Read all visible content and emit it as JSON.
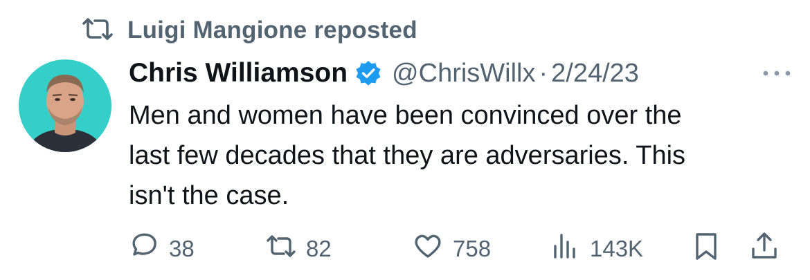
{
  "repost_banner": {
    "icon": "repost-icon",
    "text": "Luigi Mangione reposted"
  },
  "author": {
    "display_name": "Chris Williamson",
    "verified": true,
    "verified_color": "#1d9bf0",
    "handle": "@ChrisWillx",
    "separator": "·",
    "date": "2/24/23",
    "avatar_background": "#35cfc9"
  },
  "tweet": {
    "text": "Men and women have been convinced over the\nlast few decades that they are adversaries. This\nisn't the case."
  },
  "actions": {
    "replies": "38",
    "reposts": "82",
    "likes": "758",
    "views": "143K"
  },
  "colors": {
    "primary_text": "#0f1419",
    "secondary_text": "#536471",
    "background": "#ffffff"
  }
}
